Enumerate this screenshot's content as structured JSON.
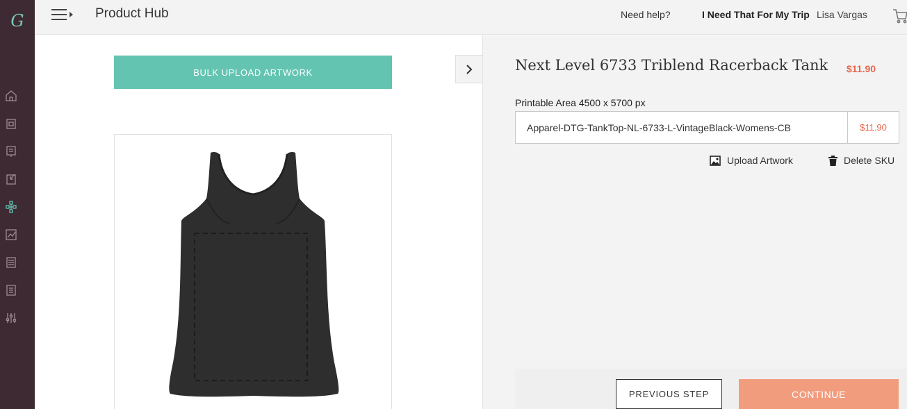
{
  "topbar": {
    "title": "Product Hub",
    "help": "Need help?",
    "store": "I Need That For My Trip",
    "user": "Lisa Vargas"
  },
  "sidebar": {
    "logo_letter": "G",
    "items": [
      {
        "icon": "home-icon"
      },
      {
        "icon": "orders-icon"
      },
      {
        "icon": "catalog-icon"
      },
      {
        "icon": "import-icon"
      },
      {
        "icon": "integrations-icon"
      },
      {
        "icon": "analytics-icon"
      },
      {
        "icon": "billing-icon"
      },
      {
        "icon": "reports-icon"
      },
      {
        "icon": "settings-icon"
      }
    ]
  },
  "left": {
    "bulk_upload": "BULK UPLOAD ARTWORK",
    "collapse_icon": "chevron-right-icon"
  },
  "product": {
    "title": "Next Level 6733 Triblend Racerback Tank",
    "price": "$11.90",
    "printable_area": "Printable Area 4500 x 5700 px",
    "sku": "Apparel-DTG-TankTop-NL-6733-L-VintageBlack-Womens-CB",
    "sku_price": "$11.90",
    "upload_artwork": "Upload Artwork",
    "delete_sku": "Delete SKU"
  },
  "footer": {
    "previous": "PREVIOUS STEP",
    "continue": "CONTINUE"
  },
  "colors": {
    "accent_teal": "#63c4b1",
    "price_orange": "#e8664b",
    "continue_bg": "#f29c7e",
    "rail_bg": "#3d2a33"
  }
}
